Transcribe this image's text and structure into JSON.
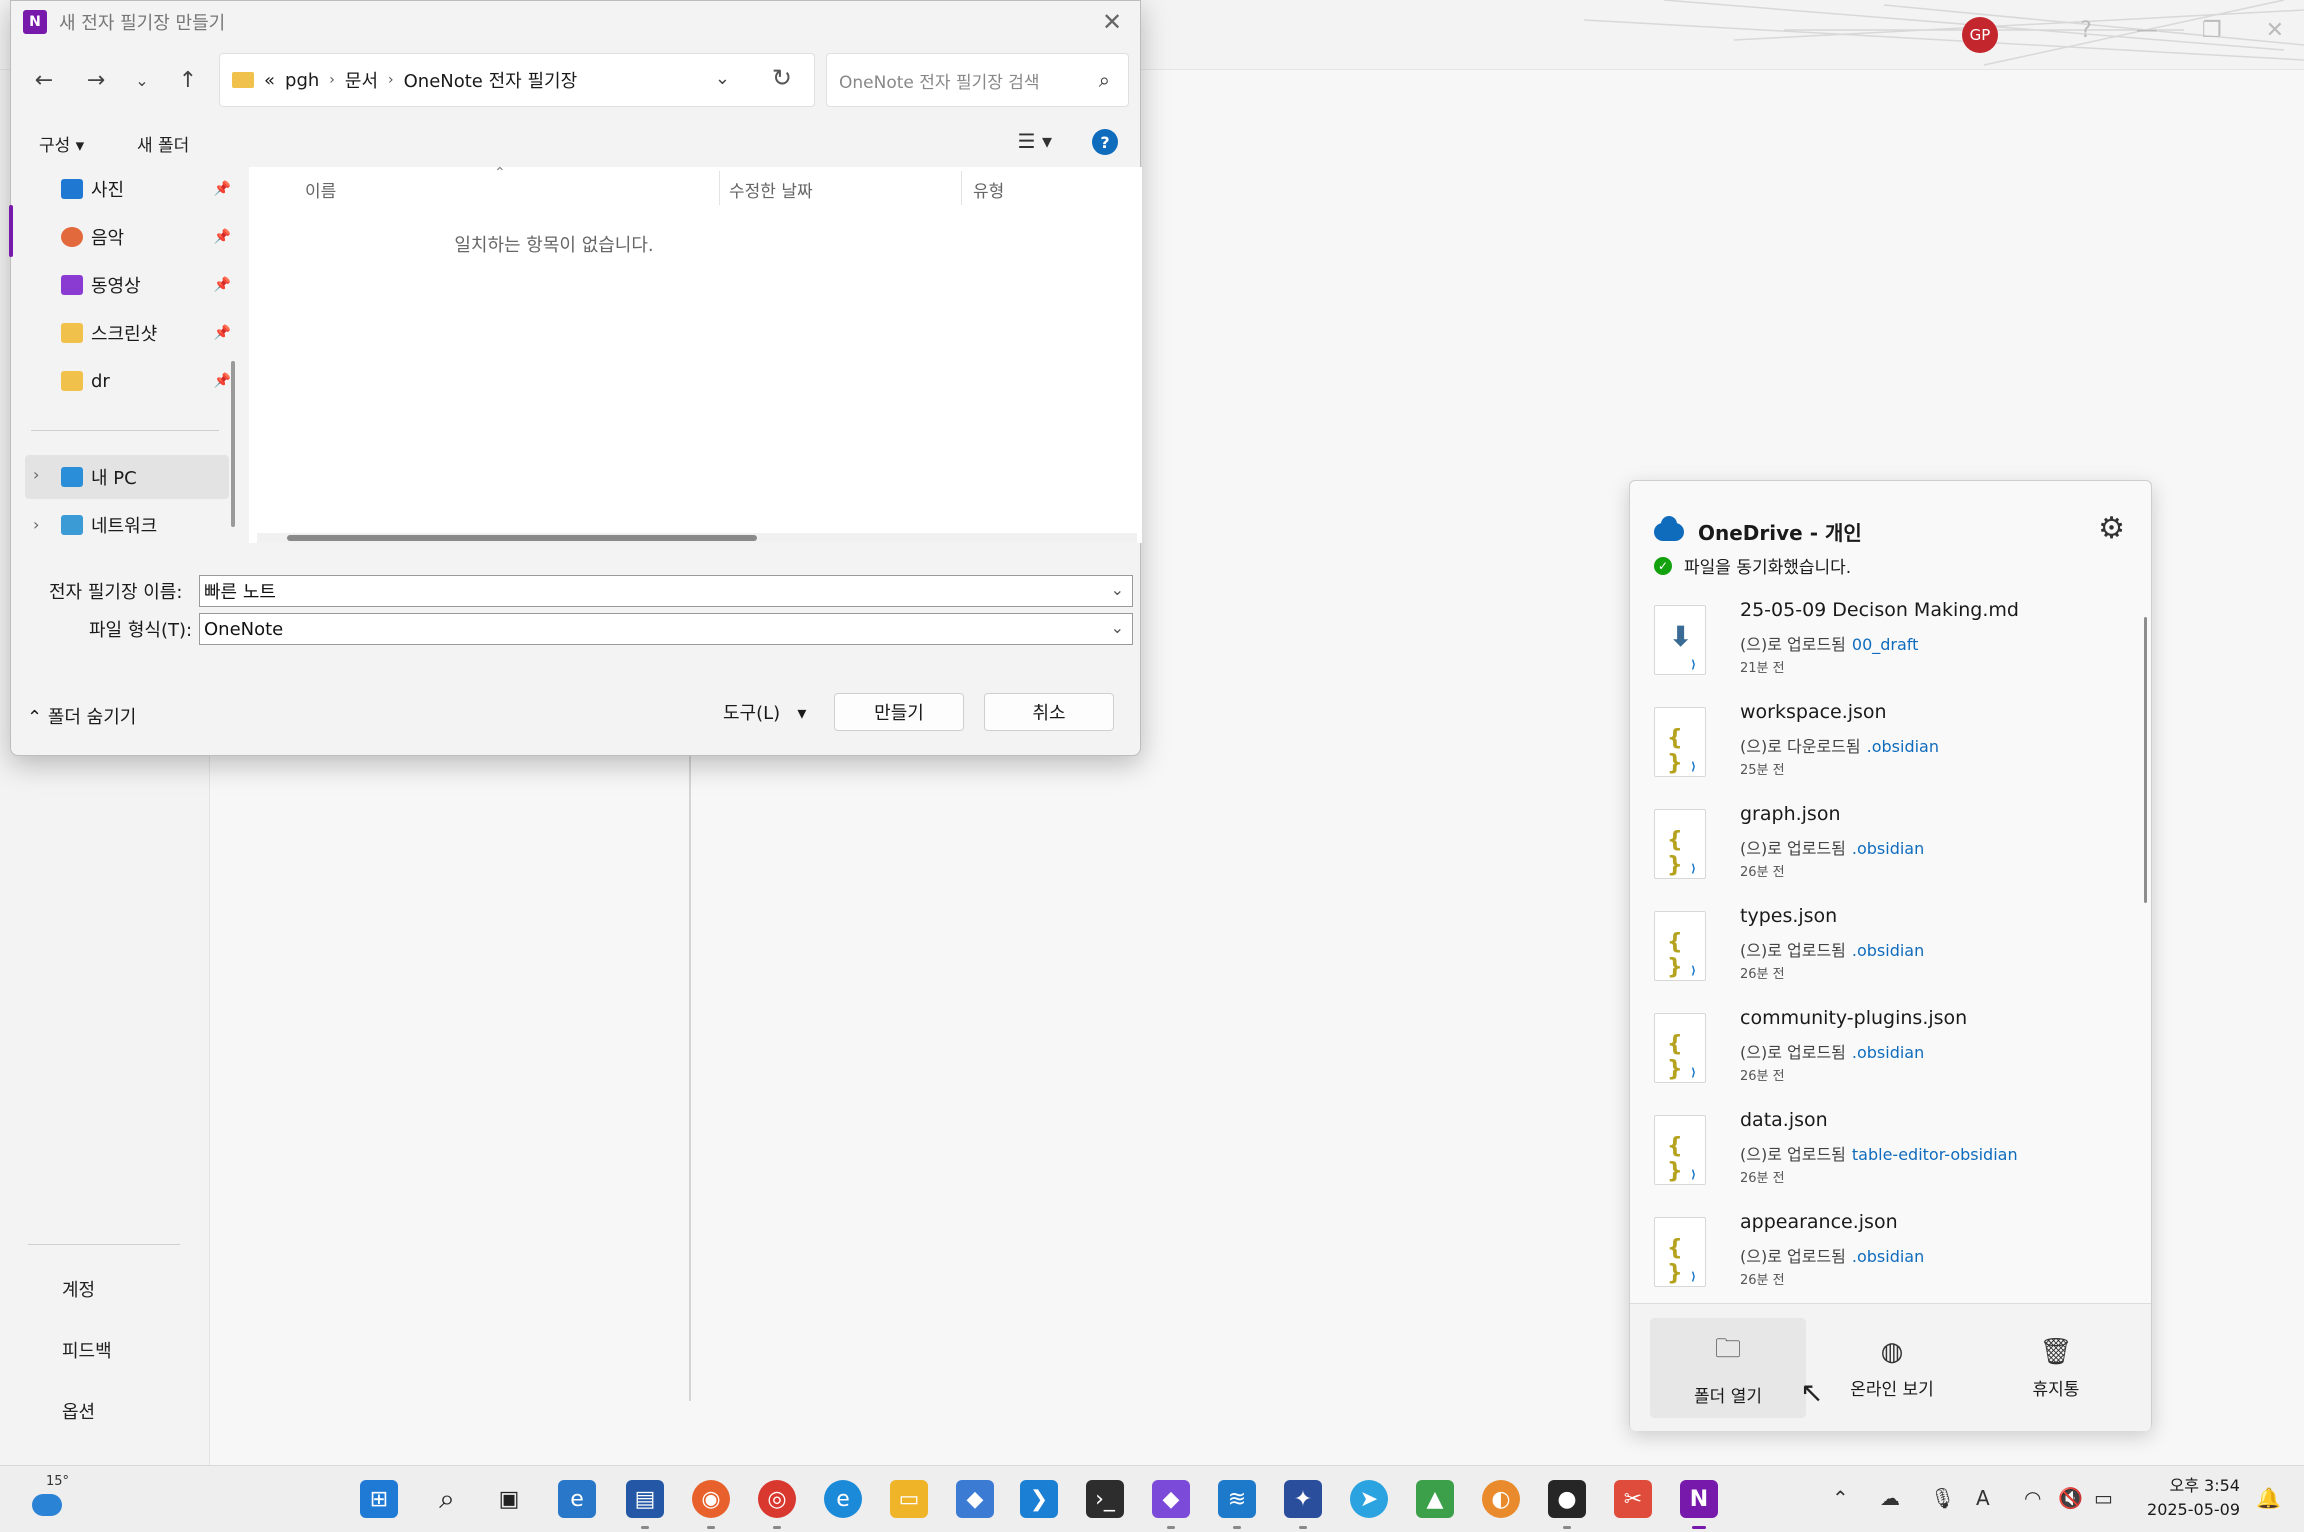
{
  "background_app": {
    "avatar_initials": "GP",
    "left_pane": {
      "items": [
        "계정",
        "피드백",
        "옵션"
      ]
    }
  },
  "dialog": {
    "title": "새 전자 필기장 만들기",
    "address": {
      "overflow": "«",
      "crumbs": [
        "pgh",
        "문서",
        "OneNote 전자 필기장"
      ]
    },
    "search_placeholder": "OneNote 전자 필기장 검색",
    "commands": {
      "organize": "구성 ▾",
      "new_folder": "새 폴더"
    },
    "nav_items": [
      {
        "label": "사진",
        "icon": "pictures-icon"
      },
      {
        "label": "음악",
        "icon": "music-icon"
      },
      {
        "label": "동영상",
        "icon": "video-icon"
      },
      {
        "label": "스크린샷",
        "icon": "folder-icon"
      },
      {
        "label": "dr",
        "icon": "folder-icon"
      }
    ],
    "nav_tree": [
      {
        "label": "내 PC",
        "icon": "pc-icon"
      },
      {
        "label": "네트워크",
        "icon": "network-icon"
      }
    ],
    "columns": [
      "이름",
      "수정한 날짜",
      "유형"
    ],
    "empty_message": "일치하는 항목이 없습니다.",
    "notebook_name_label": "전자 필기장 이름:",
    "notebook_name_value": "빠른 노트",
    "file_type_label": "파일 형식(T):",
    "file_type_value": "OneNote",
    "hide_folders": "폴더 숨기기",
    "tools": "도구(L)",
    "create": "만들기",
    "cancel": "취소"
  },
  "onedrive": {
    "title": "OneDrive - 개인",
    "status": "파일을 동기화했습니다.",
    "items": [
      {
        "name": "25-05-09 Decison Making.md",
        "action": "(으)로 업로드됨",
        "folder": "00_draft",
        "time": "21분 전",
        "icon": "download-file-icon"
      },
      {
        "name": "workspace.json",
        "action": "(으)로 다운로드됨",
        "folder": ".obsidian",
        "time": "25분 전",
        "icon": "json-file-icon"
      },
      {
        "name": "graph.json",
        "action": "(으)로 업로드됨",
        "folder": ".obsidian",
        "time": "26분 전",
        "icon": "json-file-icon"
      },
      {
        "name": "types.json",
        "action": "(으)로 업로드됨",
        "folder": ".obsidian",
        "time": "26분 전",
        "icon": "json-file-icon"
      },
      {
        "name": "community-plugins.json",
        "action": "(으)로 업로드됨",
        "folder": ".obsidian",
        "time": "26분 전",
        "icon": "json-file-icon"
      },
      {
        "name": "data.json",
        "action": "(으)로 업로드됨",
        "folder": "table-editor-obsidian",
        "time": "26분 전",
        "icon": "json-file-icon"
      },
      {
        "name": "appearance.json",
        "action": "(으)로 업로드됨",
        "folder": ".obsidian",
        "time": "26분 전",
        "icon": "json-file-icon"
      }
    ],
    "footer": {
      "open_folder": "폴더 열기",
      "view_online": "온라인 보기",
      "recycle_bin": "휴지통"
    }
  },
  "taskbar": {
    "weather_temp": "15°",
    "clock_time": "오후 3:54",
    "clock_date": "2025-05-09",
    "accent": "#7719aa"
  }
}
